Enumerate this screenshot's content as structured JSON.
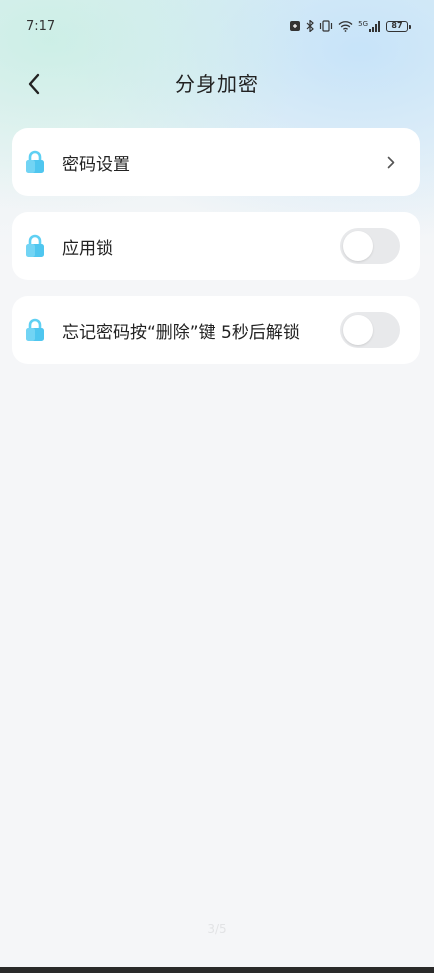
{
  "status_bar": {
    "time": "7:17",
    "battery_level": "87",
    "network_label": "5G"
  },
  "header": {
    "title": "分身加密"
  },
  "settings": {
    "password_setting": {
      "label": "密码设置"
    },
    "app_lock": {
      "label": "应用锁",
      "enabled": false
    },
    "forget_password_unlock": {
      "label": "忘记密码按“删除”键 5秒后解锁",
      "enabled": false
    }
  },
  "pager": {
    "text": "3/5"
  },
  "colors": {
    "lock_icon": "#4fc6ef",
    "toggle_off": "#e8e9eb",
    "background": "#f5f6f8"
  }
}
